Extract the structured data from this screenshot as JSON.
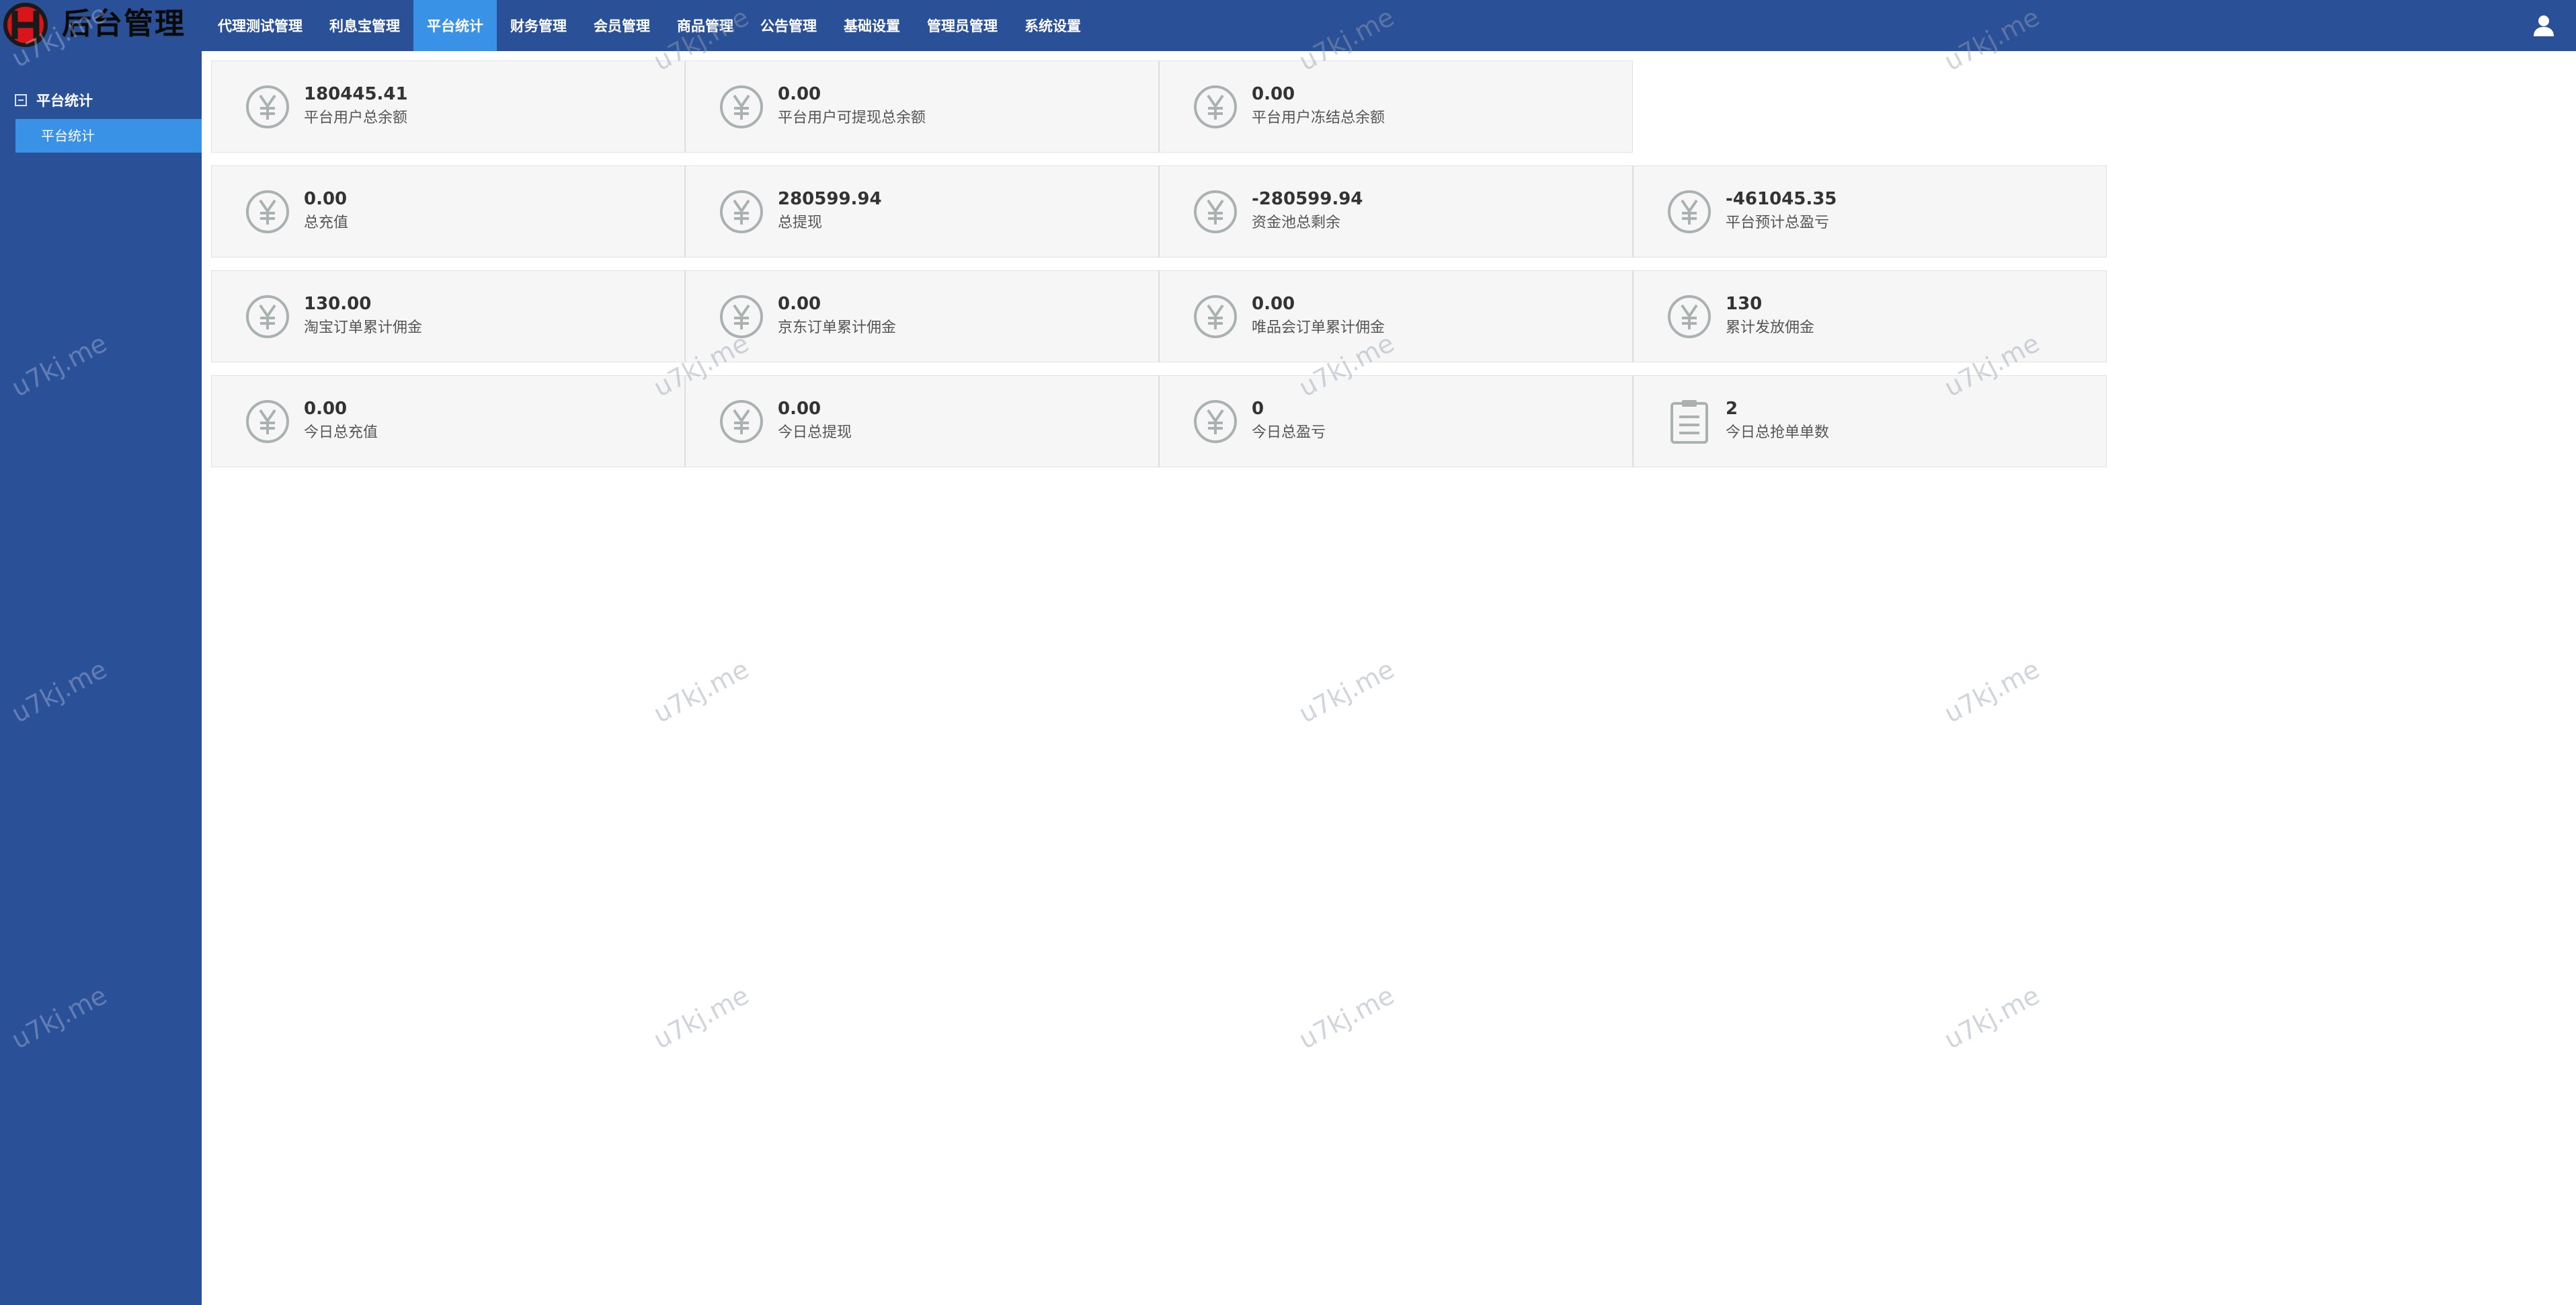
{
  "brand": {
    "title": "后台管理"
  },
  "nav": [
    {
      "label": "代理测试管理"
    },
    {
      "label": "利息宝管理"
    },
    {
      "label": "平台统计"
    },
    {
      "label": "财务管理"
    },
    {
      "label": "会员管理"
    },
    {
      "label": "商品管理"
    },
    {
      "label": "公告管理"
    },
    {
      "label": "基础设置"
    },
    {
      "label": "管理员管理"
    },
    {
      "label": "系统设置"
    }
  ],
  "nav_active_index": 2,
  "sidebar": {
    "group_label": "平台统计",
    "items": [
      {
        "label": "平台统计"
      }
    ]
  },
  "stats": {
    "row1": [
      {
        "value": "180445.41",
        "label": "平台用户总余额",
        "icon": "yen-icon"
      },
      {
        "value": "0.00",
        "label": "平台用户可提现总余额",
        "icon": "yen-icon"
      },
      {
        "value": "0.00",
        "label": "平台用户冻结总余额",
        "icon": "yen-icon"
      }
    ],
    "row2": [
      {
        "value": "0.00",
        "label": "总充值",
        "icon": "yen-icon"
      },
      {
        "value": "280599.94",
        "label": "总提现",
        "icon": "yen-icon"
      },
      {
        "value": "-280599.94",
        "label": "资金池总剩余",
        "icon": "yen-icon"
      },
      {
        "value": "-461045.35",
        "label": "平台预计总盈亏",
        "icon": "yen-icon"
      }
    ],
    "row3": [
      {
        "value": "130.00",
        "label": "淘宝订单累计佣金",
        "icon": "yen-icon"
      },
      {
        "value": "0.00",
        "label": "京东订单累计佣金",
        "icon": "yen-icon"
      },
      {
        "value": "0.00",
        "label": "唯品会订单累计佣金",
        "icon": "yen-icon"
      },
      {
        "value": "130",
        "label": "累计发放佣金",
        "icon": "yen-icon"
      }
    ],
    "row4": [
      {
        "value": "0.00",
        "label": "今日总充值",
        "icon": "yen-icon"
      },
      {
        "value": "0.00",
        "label": "今日总提现",
        "icon": "yen-icon"
      },
      {
        "value": "0",
        "label": "今日总盈亏",
        "icon": "yen-icon"
      },
      {
        "value": "2",
        "label": "今日总抢单单数",
        "icon": "clipboard-icon"
      }
    ]
  },
  "watermark": "u7kj.me",
  "colors": {
    "topbar": "#2a5198",
    "sidebar": "#2a5198",
    "active": "#3a92e6",
    "card_bg": "#f6f6f6",
    "icon": "#a9b1b1"
  }
}
